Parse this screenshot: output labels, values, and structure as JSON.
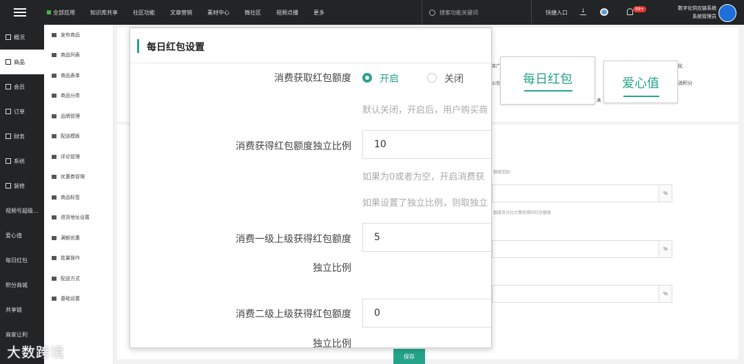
{
  "topbar": {
    "menu": [
      "全部应用",
      "知识库共享",
      "社区功能",
      "文章营销",
      "素材中心",
      "微社区",
      "视频点播",
      "更多"
    ],
    "search_placeholder": "搜索功能关键词",
    "quick_entry": "快捷入口",
    "badge": "99+",
    "user_line1": "数字化供应链系统",
    "user_line2": "系统管理员"
  },
  "sidebar": {
    "items": [
      "概况",
      "商品",
      "会员",
      "订单",
      "财务",
      "系统",
      "装修",
      "视频号超级...",
      "爱心值",
      "每日红包",
      "积分商城",
      "共享链",
      "商家让利"
    ]
  },
  "submenu": {
    "items": [
      "发布商品",
      "商品列表",
      "商品表单",
      "商品分类",
      "品牌管理",
      "配送模板",
      "评论管理",
      "优惠券管理",
      "商品标签",
      "退货地址设置",
      "满额优惠",
      "批量操作",
      "配送方式",
      "基础设置"
    ]
  },
  "background": {
    "hint1": "额度奖励:",
    "hint2": "额度百分比计算获得的红包额度",
    "pct": "%",
    "frag1": "化",
    "frag2": "消积分",
    "frag3": "奖广",
    "frag4": "公信",
    "frag5": "满",
    "save_label": "保存"
  },
  "tabs": {
    "daily_red": "每日红包",
    "love_value": "爱心值"
  },
  "modal": {
    "title": "每日红包设置",
    "field1_label": "消费获取红包额度",
    "radio_on": "开启",
    "radio_off": "关闭",
    "field1_hint": "默认关闭，开启后，用户购买商",
    "field2_label": "消费获得红包额度独立比例",
    "field2_value": "10",
    "field2_hint1": "如果为0或者为空，开启消费获",
    "field2_hint2": "如果设置了独立比例，则取独立",
    "field3_label_1": "消费一级上级获得红包额度",
    "field3_label_2": "独立比例",
    "field3_value": "5",
    "field4_label_1": "消费二级上级获得红包额度",
    "field4_label_2": "独立比例",
    "field4_value": "0"
  },
  "watermark": "大数跨境",
  "colors": {
    "accent": "#25a38a",
    "dark": "#222426"
  }
}
